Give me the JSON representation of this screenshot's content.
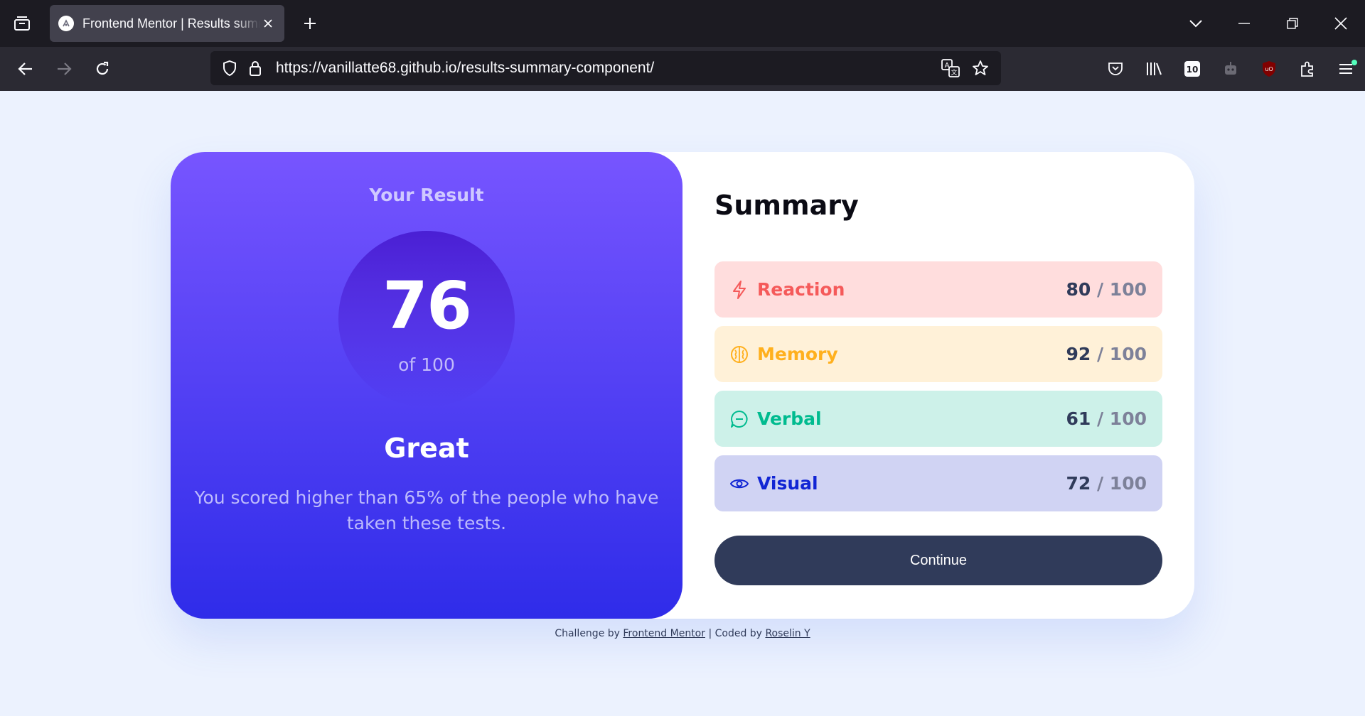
{
  "browser": {
    "tab_title": "Frontend Mentor | Results summary component",
    "url": "https://vanillatte68.github.io/results-summary-component/"
  },
  "result": {
    "heading": "Your Result",
    "score": "76",
    "of_label": "of 100",
    "rating": "Great",
    "description": "You scored higher than 65% of the people who have taken these tests."
  },
  "summary": {
    "title": "Summary",
    "items": [
      {
        "label": "Reaction",
        "score": "80",
        "denom": "/ 100",
        "icon": "lightning-icon",
        "color": "#f55a5a",
        "bg": "#ffdddd"
      },
      {
        "label": "Memory",
        "score": "92",
        "denom": "/ 100",
        "icon": "brain-icon",
        "color": "#ffb01e",
        "bg": "#fff1d8"
      },
      {
        "label": "Verbal",
        "score": "61",
        "denom": "/ 100",
        "icon": "chat-bubble-icon",
        "color": "#00bb8f",
        "bg": "#cdf1e9"
      },
      {
        "label": "Visual",
        "score": "72",
        "denom": "/ 100",
        "icon": "eye-icon",
        "color": "#1125d4",
        "bg": "#d0d3f3"
      }
    ],
    "continue_label": "Continue"
  },
  "attribution": {
    "prefix": "Challenge by",
    "link1": "Frontend Mentor",
    "middle": "| Coded by",
    "link2": "Roselin Y"
  },
  "colors": {
    "gradient_top": "#7755ff",
    "gradient_bottom": "#2f2ce9",
    "button": "#303b5a",
    "page_bg": "#ecf2fe"
  }
}
